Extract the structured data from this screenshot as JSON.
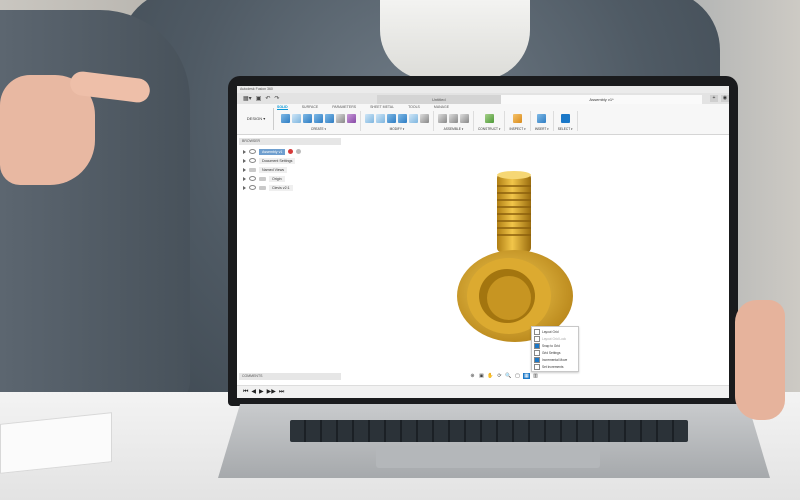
{
  "app": {
    "title": "Autodesk Fusion 360",
    "tabs": [
      {
        "label": "Untitled",
        "active": false
      },
      {
        "label": "Assembly v1*",
        "active": true
      }
    ],
    "quick_access": [
      "▦▾",
      "▣",
      "↶",
      "↷"
    ],
    "window_controls": [
      "+",
      "◉"
    ]
  },
  "toolbar": {
    "workspace": "DESIGN ▾",
    "ribbon_tabs": [
      {
        "label": "SOLID",
        "active": true
      },
      {
        "label": "SURFACE",
        "active": false
      },
      {
        "label": "PARAMETERS",
        "active": false
      },
      {
        "label": "SHEET METAL",
        "active": false
      },
      {
        "label": "TOOLS",
        "active": false
      },
      {
        "label": "MANAGE",
        "active": false
      }
    ],
    "groups": [
      {
        "label": "CREATE ▾",
        "icons": [
          "blue",
          "lblue",
          "blue",
          "blue",
          "blue",
          "gray",
          "purple"
        ]
      },
      {
        "label": "MODIFY ▾",
        "icons": [
          "lblue",
          "lblue",
          "blue",
          "blue",
          "lblue",
          "gray"
        ]
      },
      {
        "label": "ASSEMBLE ▾",
        "icons": [
          "gray",
          "gray",
          "gray"
        ]
      },
      {
        "label": "CONSTRUCT ▾",
        "icons": [
          "green"
        ]
      },
      {
        "label": "INSPECT ▾",
        "icons": [
          "orange"
        ]
      },
      {
        "label": "INSERT ▾",
        "icons": [
          "blue"
        ]
      },
      {
        "label": "SELECT ▾",
        "icons": [
          "select"
        ]
      }
    ]
  },
  "browser": {
    "header": "BROWSER",
    "root": "Assembly v1",
    "items": [
      "Document Settings",
      "Named Views",
      "Origin",
      "Clevis v2:1"
    ]
  },
  "context_menu": {
    "items": [
      {
        "label": "Layout Grid",
        "checked": false,
        "dim": false
      },
      {
        "label": "Layout Grid Lock",
        "checked": false,
        "dim": true
      },
      {
        "label": "Snap to Grid",
        "checked": true,
        "dim": false
      },
      {
        "label": "Grid Settings",
        "checked": false,
        "dim": false
      },
      {
        "label": "Incremental Move",
        "checked": true,
        "dim": false
      },
      {
        "label": "Set Increments",
        "checked": false,
        "dim": false
      }
    ]
  },
  "comments": {
    "header": "COMMENTS"
  },
  "navbar": {
    "icons": [
      "⊕",
      "▣",
      "✋",
      "⟳",
      "🔍",
      "▢",
      "▦",
      "▥"
    ]
  },
  "timeline": {
    "controls": [
      "⏮",
      "◀",
      "▶",
      "▶▶",
      "⏭"
    ]
  },
  "colors": {
    "accent": "#0696d7",
    "part": "#d9a82a"
  }
}
